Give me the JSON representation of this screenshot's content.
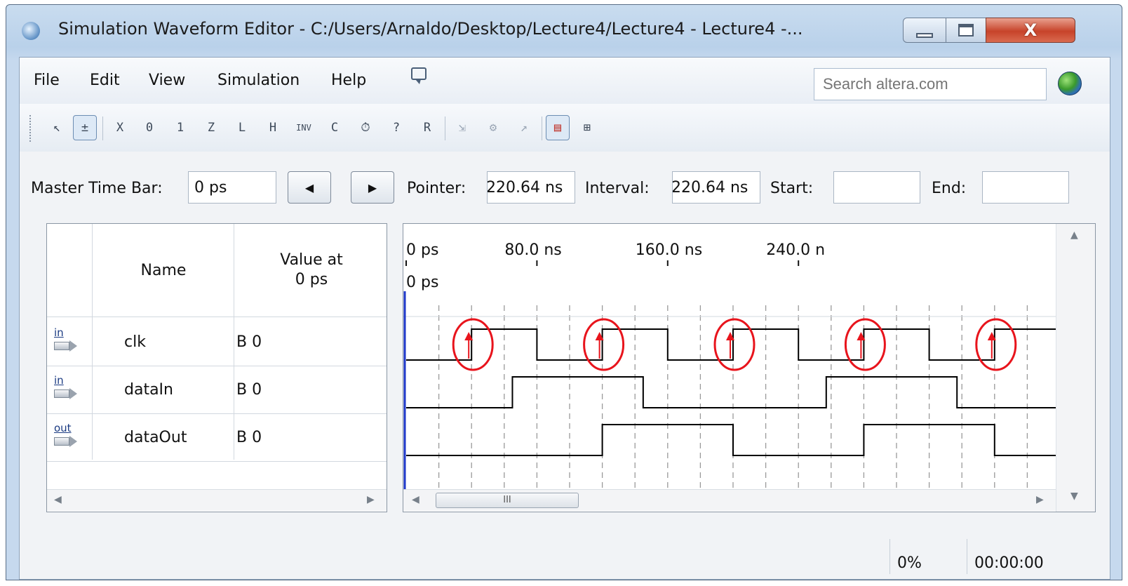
{
  "window": {
    "title": "Simulation Waveform Editor - C:/Users/Arnaldo/Desktop/Lecture4/Lecture4 - Lecture4 -...",
    "close_label": "X"
  },
  "menu": {
    "items": [
      "File",
      "Edit",
      "View",
      "Simulation",
      "Help"
    ]
  },
  "search": {
    "placeholder": "Search altera.com"
  },
  "toolbar": {
    "tools": [
      {
        "name": "selection-tool-icon",
        "glyph": "↖"
      },
      {
        "name": "zoom-tool-icon",
        "glyph": "±",
        "active": true
      },
      {
        "name": "forcing-unknown-icon",
        "glyph": "X"
      },
      {
        "name": "forcing-low-icon",
        "glyph": "0"
      },
      {
        "name": "forcing-high-icon",
        "glyph": "1"
      },
      {
        "name": "high-impedance-icon",
        "glyph": "Z"
      },
      {
        "name": "weak-low-icon",
        "glyph": "L"
      },
      {
        "name": "weak-high-icon",
        "glyph": "H"
      },
      {
        "name": "invert-icon",
        "glyph": "INV"
      },
      {
        "name": "count-value-icon",
        "glyph": "C"
      },
      {
        "name": "overwrite-clock-icon",
        "glyph": "⏱"
      },
      {
        "name": "arbitrary-value-icon",
        "glyph": "?"
      },
      {
        "name": "random-values-icon",
        "glyph": "R"
      },
      {
        "name": "snap-to-grid-icon",
        "glyph": "⇲"
      },
      {
        "name": "grid-setting-icon",
        "glyph": "⚙"
      },
      {
        "name": "edge-icon",
        "glyph": "↗"
      },
      {
        "name": "timing-simulation-icon",
        "glyph": "▤",
        "active": true
      },
      {
        "name": "node-finder-icon",
        "glyph": "⊞"
      }
    ]
  },
  "timebar": {
    "master_label": "Master Time Bar:",
    "master_value": "0 ps",
    "pointer_label": "Pointer:",
    "pointer_value": "220.64 ns",
    "interval_label": "Interval:",
    "interval_value": "220.64 ns",
    "start_label": "Start:",
    "start_value": "",
    "end_label": "End:",
    "end_value": ""
  },
  "signal_table": {
    "columns": [
      "Name",
      "Value at\n0 ps"
    ],
    "col_name": "Name",
    "col_value_line1": "Value at",
    "col_value_line2": "0 ps",
    "rows": [
      {
        "io": "in",
        "name": "clk",
        "value": "B 0"
      },
      {
        "io": "in",
        "name": "dataIn",
        "value": "B 0"
      },
      {
        "io": "out",
        "name": "dataOut",
        "value": "B 0"
      }
    ]
  },
  "waveform": {
    "time_labels": [
      "0 ps",
      "80.0 ns",
      "160.0 ns",
      "240.0 n"
    ],
    "cursor_label": "0 ps",
    "scroll_grip": "III",
    "time_unit": "ns",
    "grid_step_ns": 10,
    "visible_range_ns": [
      0,
      250
    ],
    "signals": {
      "clk": [
        [
          0,
          0
        ],
        [
          40,
          1
        ],
        [
          80,
          0
        ],
        [
          120,
          1
        ],
        [
          160,
          0
        ],
        [
          200,
          1
        ],
        [
          240,
          0
        ],
        [
          280,
          1
        ],
        [
          320,
          0
        ],
        [
          360,
          1
        ],
        [
          400,
          1
        ]
      ],
      "dataIn": [
        [
          0,
          0
        ],
        [
          65,
          1
        ],
        [
          145,
          0
        ],
        [
          257,
          1
        ],
        [
          337,
          0
        ]
      ],
      "dataOut": [
        [
          0,
          0
        ],
        [
          120,
          1
        ],
        [
          200,
          0
        ],
        [
          280,
          1
        ],
        [
          360,
          0
        ]
      ]
    },
    "highlighted_rising_edges_ns": [
      40,
      120,
      200,
      280,
      360
    ],
    "highlight_color": "#e8141c",
    "wave_color": "#000000"
  },
  "status": {
    "progress": "0%",
    "elapsed": "00:00:00"
  }
}
